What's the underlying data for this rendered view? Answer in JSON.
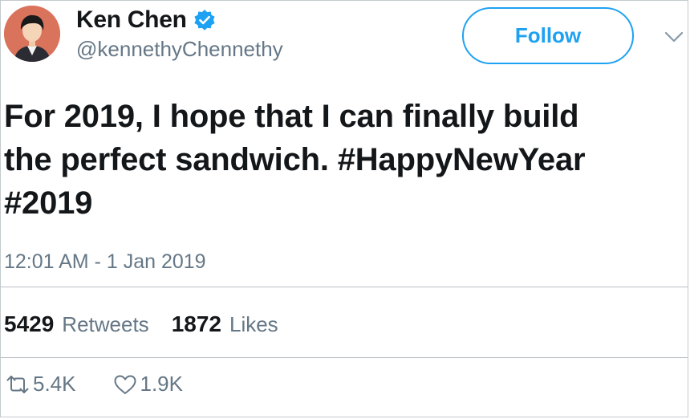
{
  "author": {
    "name": "Ken Chen",
    "handle": "@kennethyChennethy",
    "verified": true,
    "avatar_bg": "#d9735c"
  },
  "follow_button": {
    "label": "Follow",
    "color": "#1da1f2"
  },
  "menu_icon": "chevron-down-icon",
  "tweet": {
    "line1": "For 2019, I hope that I can finally build",
    "line2_text": "the perfect sandwich. ",
    "hashtag1": "#HappyNewYear",
    "hashtag2": "#2019",
    "timestamp": "12:01 AM - 1 Jan 2019"
  },
  "stats": {
    "retweets": {
      "count": "5429",
      "label": "Retweets"
    },
    "likes": {
      "count": "1872",
      "label": "Likes"
    }
  },
  "actions": {
    "retweet": {
      "icon": "retweet-icon",
      "count": "5.4K"
    },
    "like": {
      "icon": "heart-icon",
      "count": "1.9K"
    }
  },
  "colors": {
    "text": "#14171a",
    "secondary": "#657786",
    "accent": "#1da1f2",
    "verified": "#1da1f2"
  }
}
